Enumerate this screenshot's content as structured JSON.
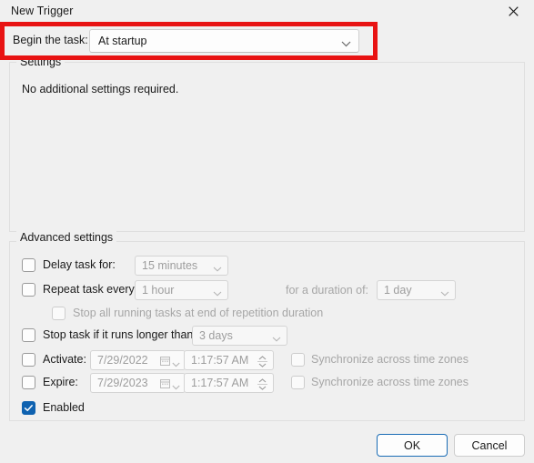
{
  "window": {
    "title": "New Trigger",
    "close_icon": "close-icon"
  },
  "begin_task": {
    "label": "Begin the task:",
    "selected": "At startup",
    "chevron_icon": "chevron-down-icon",
    "highlight_color": "#e81313"
  },
  "settings": {
    "caption": "Settings",
    "message": "No additional settings required."
  },
  "advanced": {
    "caption": "Advanced settings",
    "delay": {
      "label": "Delay task for:",
      "checked": false,
      "value": "15 minutes"
    },
    "repeat": {
      "label": "Repeat task every:",
      "checked": false,
      "value": "1 hour",
      "duration_label": "for a duration of:",
      "duration_value": "1 day"
    },
    "stop_repetition": {
      "label": "Stop all running tasks at end of repetition duration",
      "checked": false,
      "disabled": true
    },
    "stop_longer": {
      "label": "Stop task if it runs longer than:",
      "checked": false,
      "value": "3 days"
    },
    "activate": {
      "label": "Activate:",
      "checked": false,
      "date": "7/29/2022",
      "time": "1:17:57 AM",
      "sync_label": "Synchronize across time zones",
      "sync_checked": false
    },
    "expire": {
      "label": "Expire:",
      "checked": false,
      "date": "7/29/2023",
      "time": "1:17:57 AM",
      "sync_label": "Synchronize across time zones",
      "sync_checked": false
    },
    "enabled": {
      "label": "Enabled",
      "checked": true,
      "accent_color": "#0f62b0"
    }
  },
  "footer": {
    "ok_label": "OK",
    "cancel_label": "Cancel"
  }
}
